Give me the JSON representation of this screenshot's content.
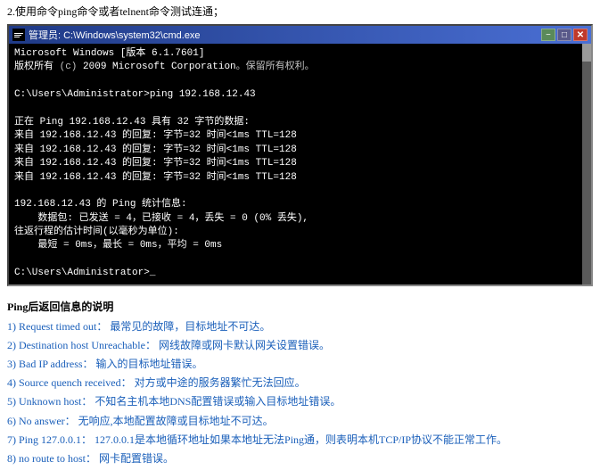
{
  "instruction": "2.使用命令ping命令或者telnent命令测试连通；",
  "cmd": {
    "title": "管理员: C:\\Windows\\system32\\cmd.exe",
    "lines": [
      "Microsoft Windows [版本 6.1.7601]",
      "版权所有 (c) 2009 Microsoft Corporation。保留所有权利。",
      "",
      "C:\\Users\\Administrator>ping 192.168.12.43",
      "",
      "正在 Ping 192.168.12.43 具有 32 字节的数据:",
      "来自 192.168.12.43 的回复: 字节=32 时间<1ms TTL=128",
      "来自 192.168.12.43 的回复: 字节=32 时间<1ms TTL=128",
      "来自 192.168.12.43 的回复: 字节=32 时间<1ms TTL=128",
      "来自 192.168.12.43 的回复: 字节=32 时间<1ms TTL=128",
      "",
      "192.168.12.43 的 Ping 统计信息:",
      "    数据包: 已发送 = 4，已接收 = 4，丢失 = 0 (0% 丢失),",
      "往返行程的估计时间(以毫秒为单位):",
      "    最短 = 0ms，最长 = 0ms，平均 = 0ms",
      "",
      "C:\\Users\\Administrator>_"
    ]
  },
  "ping_info": {
    "title": "Ping后返回信息的说明",
    "items": [
      {
        "num": "1)",
        "label": "Request timed out：",
        "text": "最常见的故障，目标地址不可达。"
      },
      {
        "num": "2)",
        "label": "Destination host Unreachable：",
        "text": "网线故障或网卡默认网关设置错误。"
      },
      {
        "num": "3)",
        "label": "Bad IP address：",
        "text": "输入的目标地址错误。"
      },
      {
        "num": "4)",
        "label": "Source quench received：",
        "text": "对方或中途的服务器繁忙无法回应。"
      },
      {
        "num": "5)",
        "label": "Unknown host：",
        "text": "不知名主机本地DNS配置错误或输入目标地址错误。"
      },
      {
        "num": "6)",
        "label": "No answer：",
        "text": "无响应,本地配置故障或目标地址不可达。"
      },
      {
        "num": "7)",
        "label": "Ping 127.0.0.1：",
        "text": "127.0.0.1是本地循环地址如果本地址无法Ping通，则表明本机TCP/IP协议不能正常工作。"
      },
      {
        "num": "8)",
        "label": "no route to host：",
        "text": "网卡配置错误。"
      }
    ]
  }
}
